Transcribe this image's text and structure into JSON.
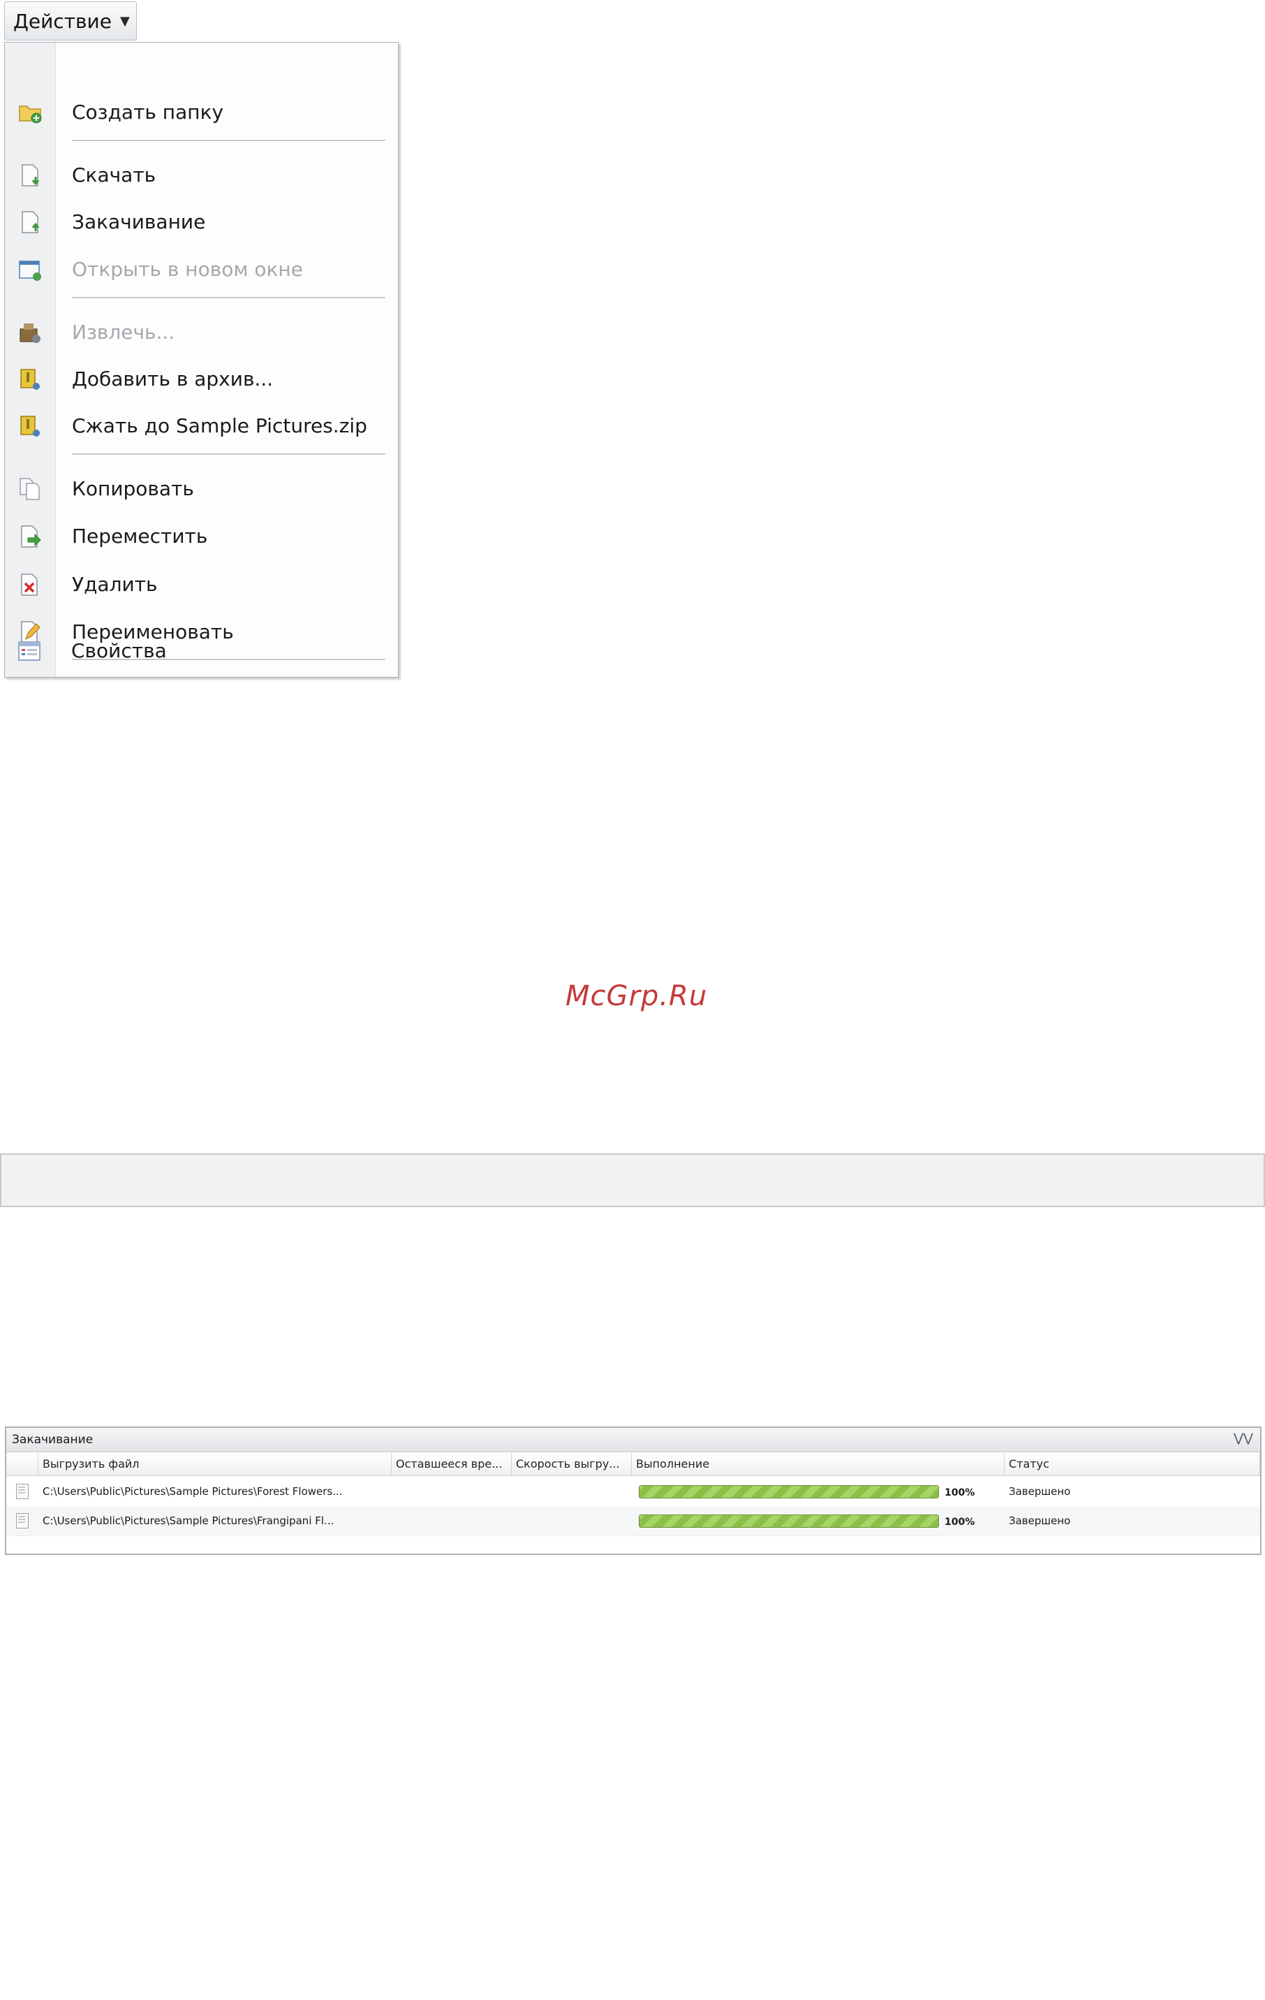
{
  "action_menu": {
    "button_label": "Действие",
    "items": [
      {
        "label": "Создать папку",
        "icon": "new-folder-icon",
        "disabled": false
      },
      {
        "label": "Скачать",
        "icon": "download-icon",
        "disabled": false
      },
      {
        "label": "Закачивание",
        "icon": "upload-icon",
        "disabled": false
      },
      {
        "label": "Открыть в новом окне",
        "icon": "new-window-icon",
        "disabled": true
      },
      {
        "label": "Извлечь...",
        "icon": "extract-icon",
        "disabled": true
      },
      {
        "label": "Добавить в архив...",
        "icon": "add-archive-icon",
        "disabled": false
      },
      {
        "label": "Сжать до Sample Pictures.zip",
        "icon": "compress-zip-icon",
        "disabled": false
      },
      {
        "label": "Копировать",
        "icon": "copy-icon",
        "disabled": false
      },
      {
        "label": "Переместить",
        "icon": "move-icon",
        "disabled": false
      },
      {
        "label": "Удалить",
        "icon": "delete-icon",
        "disabled": false
      },
      {
        "label": "Переименовать",
        "icon": "rename-icon",
        "disabled": false
      },
      {
        "label": "Свойства",
        "icon": "properties-icon",
        "disabled": false
      }
    ]
  },
  "watermark": "McGrp.Ru",
  "upload_panel": {
    "title": "Закачивание",
    "columns": [
      "Выгрузить файл",
      "Оставшееся вре...",
      "Скорость выгру...",
      "Выполнение",
      "Статус"
    ],
    "rows": [
      {
        "file": "C:\\Users\\Public\\Pictures\\Sample Pictures\\Forest Flowers...",
        "remaining": "",
        "speed": "",
        "progress": 100,
        "progress_label": "100%",
        "status": "Завершено"
      },
      {
        "file": "C:\\Users\\Public\\Pictures\\Sample Pictures\\Frangipani Fl...",
        "remaining": "",
        "speed": "",
        "progress": 100,
        "progress_label": "100%",
        "status": "Завершено"
      }
    ]
  },
  "colors": {
    "progress": "#8bbf47",
    "disabled_text": "#a4a8ad",
    "watermark": "#c43a3a"
  }
}
